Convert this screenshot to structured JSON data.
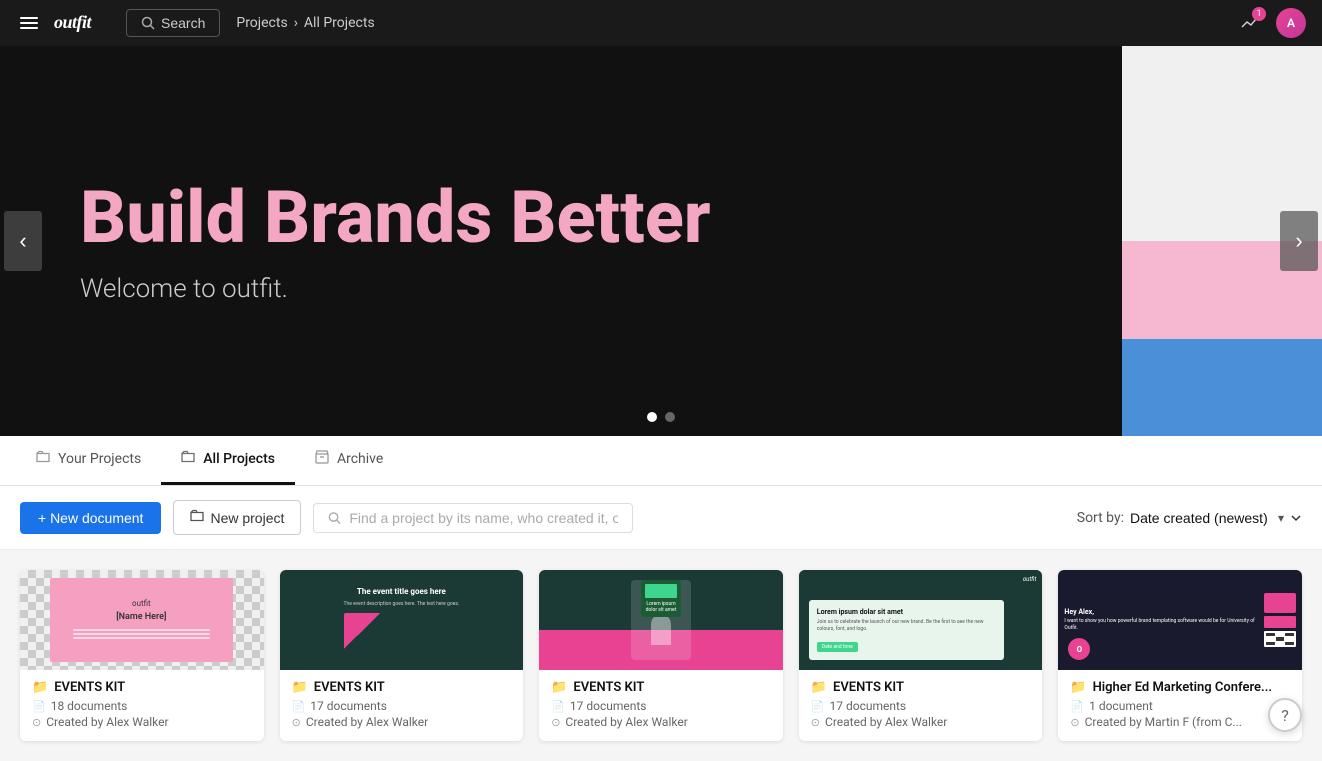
{
  "header": {
    "logo": "outfit",
    "search_label": "Search",
    "breadcrumb_root": "Projects",
    "breadcrumb_sep": "›",
    "breadcrumb_current": "All Projects",
    "notification_count": "1",
    "user_initials": "A"
  },
  "hero": {
    "slide1_title": "Build Brands Better",
    "slide1_subtitle": "Welcome to outfit.",
    "prev_label": "‹",
    "next_label": "›",
    "dots": [
      {
        "active": true
      },
      {
        "active": false
      }
    ]
  },
  "tabs": [
    {
      "label": "Your Projects",
      "icon": "📁",
      "active": false
    },
    {
      "label": "All Projects",
      "icon": "📁",
      "active": true
    },
    {
      "label": "Archive",
      "icon": "📁",
      "active": false
    }
  ],
  "toolbar": {
    "new_document_label": "+ New document",
    "new_project_label": "New project",
    "search_placeholder": "Find a project by its name, who created it, or its team.",
    "sort_label": "Sort by:",
    "sort_value": "Date created (newest)"
  },
  "projects": [
    {
      "name": "EVENTS KIT",
      "doc_count": "18 documents",
      "created_by": "Created by Alex Walker",
      "thumb_type": "pink-name"
    },
    {
      "name": "EVENTS KIT",
      "doc_count": "17 documents",
      "created_by": "Created by Alex Walker",
      "thumb_type": "dark-event"
    },
    {
      "name": "EVENTS KIT",
      "doc_count": "17 documents",
      "created_by": "Created by Alex Walker",
      "thumb_type": "person"
    },
    {
      "name": "EVENTS KIT",
      "doc_count": "17 documents",
      "created_by": "Created by Alex Walker",
      "thumb_type": "teal-card"
    },
    {
      "name": "Higher Ed Marketing Confere...",
      "doc_count": "1 document",
      "created_by": "Created by Martin F (from C...",
      "thumb_type": "higher-ed"
    }
  ]
}
